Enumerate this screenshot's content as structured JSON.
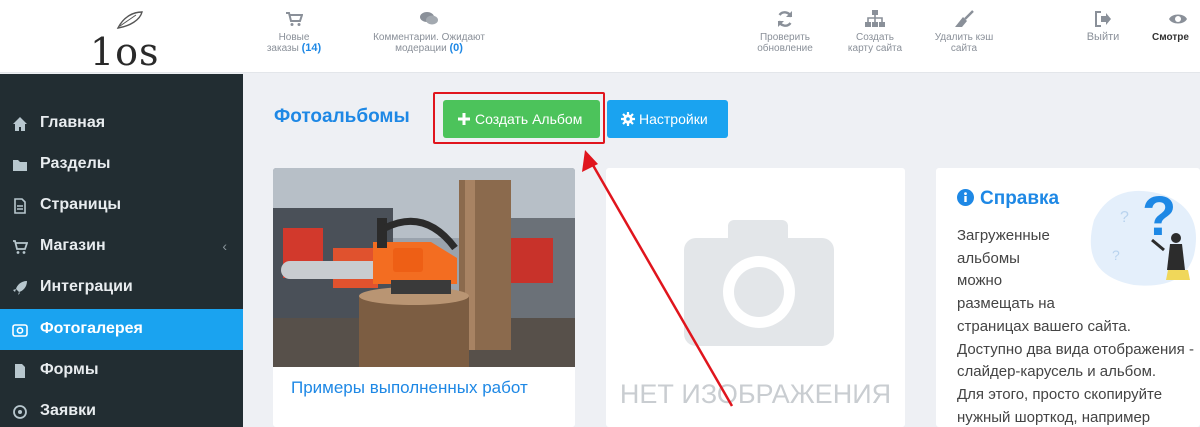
{
  "logo": {
    "text": "1os"
  },
  "topbar": {
    "orders": {
      "icon": "cart-icon",
      "line1": "Новые",
      "line2": "заказы",
      "count": "(14)"
    },
    "comments": {
      "icon": "comments-icon",
      "line1": "Комментарии. Ожидают",
      "line2": "модерации",
      "count": "(0)"
    },
    "update": {
      "icon": "refresh-icon",
      "line1": "Проверить",
      "line2": "обновление"
    },
    "sitemap": {
      "icon": "sitemap-icon",
      "line1": "Создать",
      "line2": "карту сайта"
    },
    "cache": {
      "icon": "broom-icon",
      "line1": "Удалить кэш",
      "line2": "сайта"
    },
    "logout": {
      "icon": "logout-icon",
      "label": "Выйти"
    },
    "view": {
      "label": "Смотре"
    }
  },
  "sidebar": {
    "items": [
      {
        "label": "Главная",
        "icon": "home-icon"
      },
      {
        "label": "Разделы",
        "icon": "folder-icon"
      },
      {
        "label": "Страницы",
        "icon": "file-icon"
      },
      {
        "label": "Магазин",
        "icon": "cart-icon",
        "caret": "‹"
      },
      {
        "label": "Интеграции",
        "icon": "rocket-icon"
      },
      {
        "label": "Фотогалерея",
        "icon": "camera-icon",
        "active": true
      },
      {
        "label": "Формы",
        "icon": "file-solid-icon"
      },
      {
        "label": "Заявки",
        "icon": "target-icon"
      }
    ]
  },
  "main": {
    "title": "Фотоальбомы",
    "create_button": "Создать Альбом",
    "settings_button": "Настройки",
    "albums": [
      {
        "title": "Примеры выполненных работ"
      },
      {
        "placeholder_text": "НЕТ ИЗОБРАЖЕНИЯ"
      }
    ]
  },
  "help": {
    "title": "Справка",
    "lines": [
      "Загруженные",
      "альбомы",
      "можно",
      "размещать на",
      "страницах вашего сайта.",
      "Доступно два вида отображения -",
      "слайдер-карусель и альбом.",
      "Для этого, просто скопируйте",
      "нужный шорткод, например"
    ]
  },
  "colors": {
    "accent": "#1e88e5",
    "sidebar_bg": "#222d32",
    "active": "#1aa3f0",
    "success": "#4cc35b",
    "annotation": "#e0151d"
  }
}
